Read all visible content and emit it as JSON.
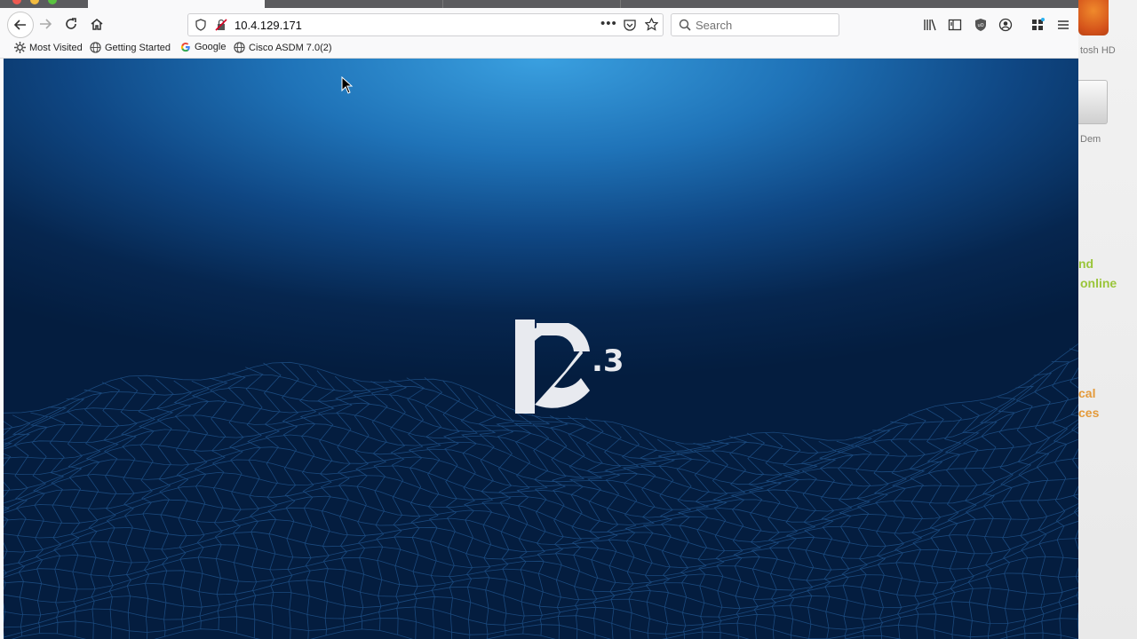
{
  "browser": {
    "url": "10.4.129.171",
    "search_placeholder": "Search",
    "bookmarks": [
      {
        "label": "Most Visited",
        "icon": "gear-icon"
      },
      {
        "label": "Getting Started",
        "icon": "globe-icon"
      },
      {
        "label": "Google",
        "icon": "google-icon"
      },
      {
        "label": "Cisco ASDM 7.0(2)",
        "icon": "globe-icon"
      }
    ]
  },
  "page": {
    "logo_superscript": ".3"
  },
  "desktop": {
    "drive_label_1": "tosh HD",
    "drive_label_2": "Dem",
    "ad_text_1a": "nd",
    "ad_text_1b": "online",
    "ad_text_2a": "cal",
    "ad_text_2b": "ces"
  },
  "colors": {
    "hero_top": "#3aa0e0",
    "hero_bottom": "#041d3f",
    "mesh": "#2d6db0",
    "logo": "#e8eaef",
    "desktop_green": "#9ac53a",
    "desktop_orange": "#e49a3a"
  }
}
